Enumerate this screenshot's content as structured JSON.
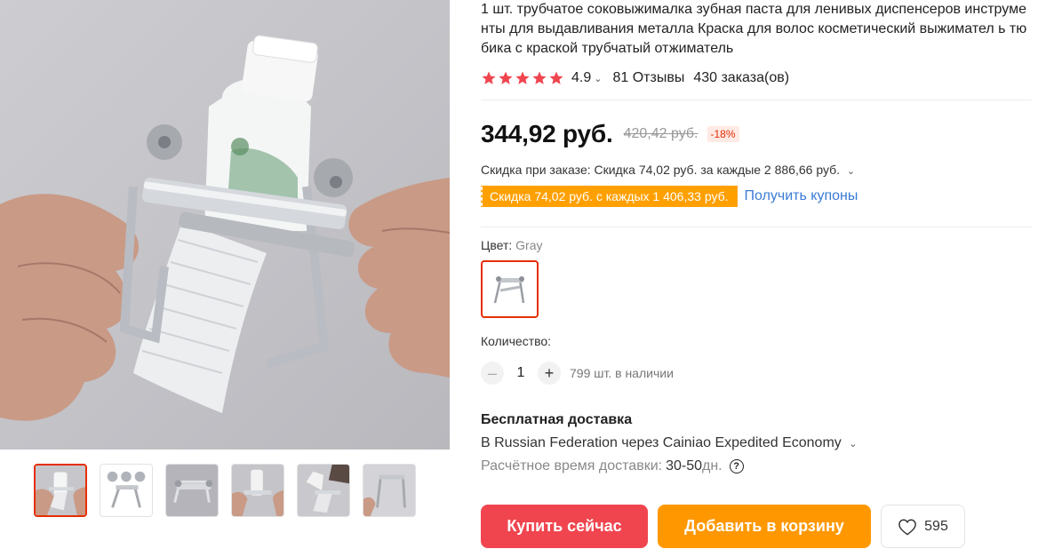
{
  "product": {
    "title": "1 шт. трубчатое соковыжималка зубная паста для ленивых диспенсеров инструменты для выдавливания металла Краска для волос косметический выжимател ь тюбика с краской трубчатый отжиматель"
  },
  "rating": {
    "stars": 5,
    "value": "4.9",
    "reviews": "81 Отзывы",
    "orders": "430 заказа(ов)",
    "star_color": "#f0454f"
  },
  "price": {
    "current": "344,92 руб.",
    "original": "420,42 руб.",
    "discount": "-18%"
  },
  "discounts": {
    "order_discount": "Скидка при заказе: Скидка 74,02 руб. за каждые 2 886,66 руб.",
    "coupon": "Скидка 74,02 руб. с каждых 1 406,33 руб.",
    "get_coupons": "Получить купоны"
  },
  "color": {
    "label": "Цвет:",
    "value": "Gray"
  },
  "quantity": {
    "label": "Количество:",
    "value": "1",
    "stock": "799 шт. в наличии"
  },
  "shipping": {
    "title": "Бесплатная доставка",
    "method": "В Russian Federation через Cainiao Expedited Economy",
    "time_label": "Расчётное время доставки:",
    "days": "30-50",
    "unit": "дн."
  },
  "actions": {
    "buy_now": "Купить сейчас",
    "add_to_cart": "Добавить в корзину",
    "wishlist_count": "595"
  },
  "colors": {
    "primary_red": "#f0454f",
    "orange": "#ff9800",
    "coupon_orange": "#ffa000",
    "link_blue": "#3a7bd5",
    "selected_border": "#e62e04"
  },
  "gallery": {
    "thumbnails": 6,
    "selected": 0
  }
}
